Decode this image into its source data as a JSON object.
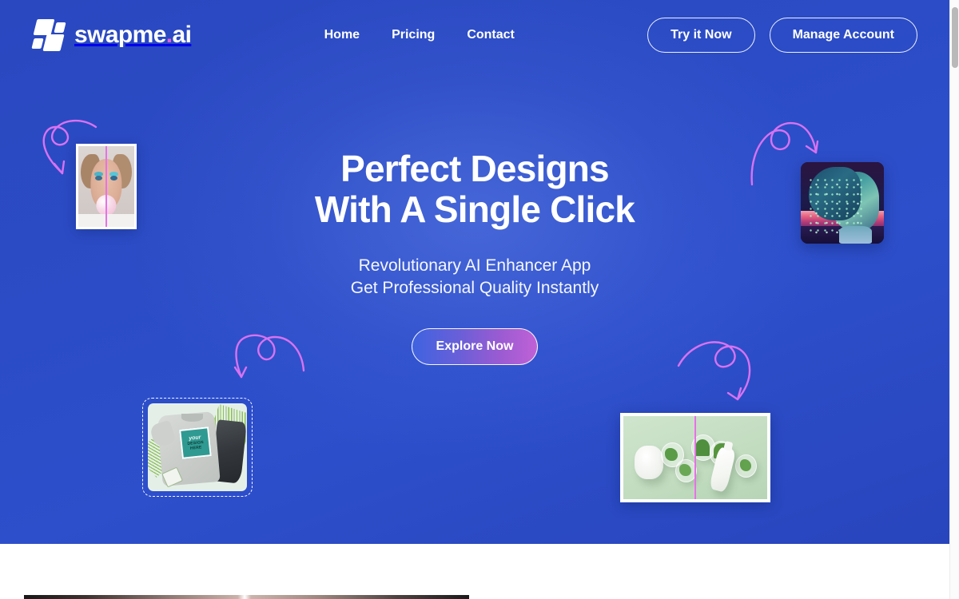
{
  "brand": {
    "name": "swapme",
    "suffix_dot": ".",
    "suffix": "ai",
    "logo_icon": "swapme-logo-mark"
  },
  "nav": {
    "links": [
      {
        "label": "Home"
      },
      {
        "label": "Pricing"
      },
      {
        "label": "Contact"
      }
    ],
    "actions": [
      {
        "label": "Try it Now"
      },
      {
        "label": "Manage Account"
      }
    ]
  },
  "hero": {
    "title_line1": "Perfect Designs",
    "title_line2": "With A Single Click",
    "sub_line1": "Revolutionary AI Enhancer App",
    "sub_line2": "Get Professional Quality Instantly",
    "cta_label": "Explore Now",
    "background_color": "#2B4CC4",
    "cta_gradient_from": "#3F63E0",
    "cta_gradient_to": "#C061D6",
    "accent_color": "#E05FD8",
    "arrow_color": "#D972F0"
  },
  "showcase": {
    "face_card": {
      "name": "before-after-portrait",
      "divider_color": "#E871E8"
    },
    "ai_art_card": {
      "name": "ai-generated-portrait"
    },
    "tshirt_card": {
      "name": "tshirt-mockup",
      "design_text_top": "your",
      "design_text_bottom": "DESIGN HERE",
      "border_style": "dashed"
    },
    "cosmetic_card": {
      "name": "cosmetics-flatlay",
      "divider_color": "#E871E8"
    },
    "arrows": [
      {
        "name": "arrow-to-portrait",
        "direction": "down-right"
      },
      {
        "name": "arrow-to-ai-art",
        "direction": "down-right"
      },
      {
        "name": "arrow-to-tshirt",
        "direction": "down-left"
      },
      {
        "name": "arrow-to-cosmetics",
        "direction": "down-right"
      }
    ]
  },
  "scrollbar": {
    "name": "page-scrollbar",
    "thumb_position_percent": 2
  }
}
